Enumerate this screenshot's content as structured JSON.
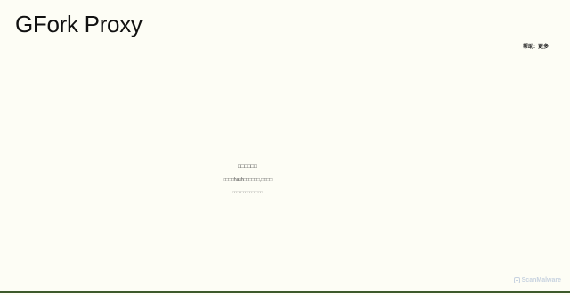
{
  "header": {
    "title": "GFork Proxy"
  },
  "nav": {
    "left_label": "帮助:",
    "more_label": "更多"
  },
  "content": {
    "heading": "□□□□□□",
    "line1": "□□□□hash□□□□□□,□□□□",
    "line2": "□□□□□□□□□□□□□□"
  },
  "watermark": {
    "text": "ScanMalware"
  },
  "colors": {
    "background": "#fdfdf5",
    "bottom_bar": "#3d5a2c"
  }
}
